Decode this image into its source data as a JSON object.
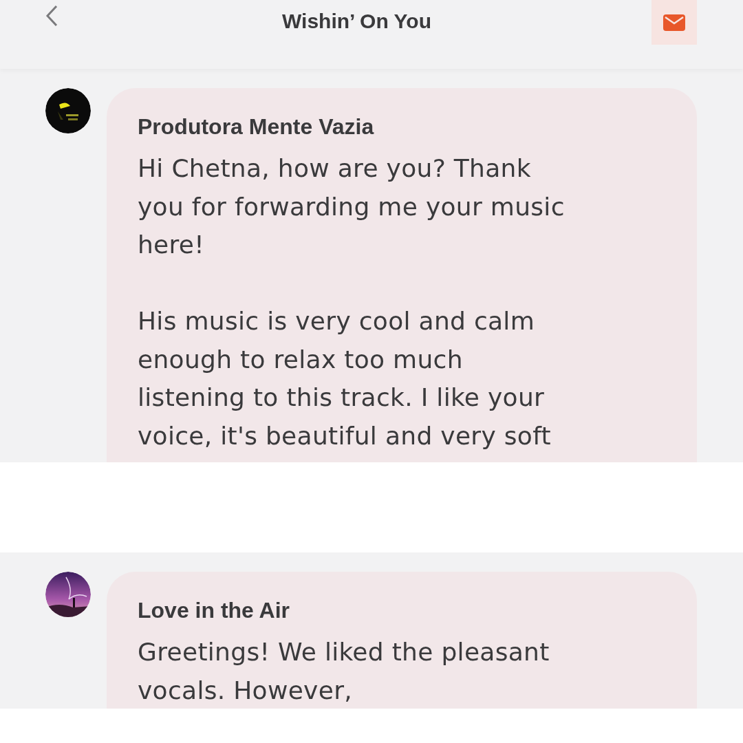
{
  "header": {
    "title": "Wishin’ On You"
  },
  "panels": [
    {
      "messages": [
        {
          "sender": "Produtora Mente Vazia",
          "text": "Hi Chetna, how are you? Thank\nyou for forwarding me your music\nhere!\n\nHis music is very cool and calm\nenough to relax too much\nlistening to this track. I like your\nvoice, it's beautiful and very soft"
        }
      ]
    },
    {
      "messages": [
        {
          "sender": "Love in the Air",
          "text": "Greetings! We liked the pleasant\nvocals. However,"
        }
      ]
    }
  ]
}
